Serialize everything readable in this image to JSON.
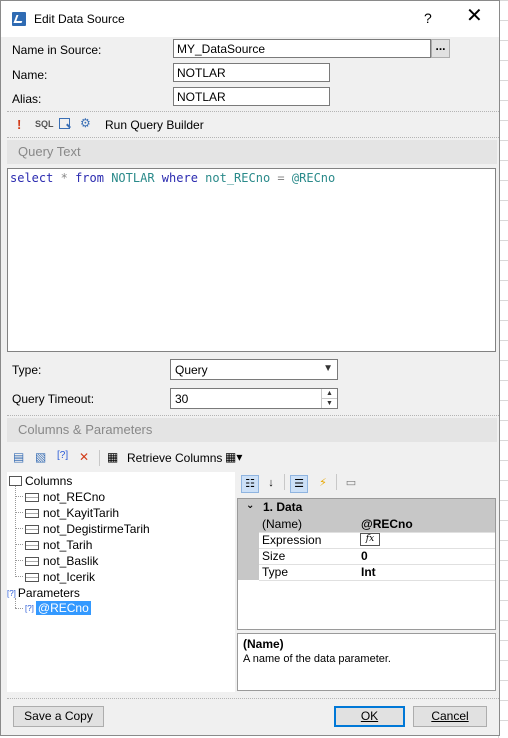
{
  "window": {
    "title": "Edit Data Source",
    "help": "?",
    "close": "✕"
  },
  "form": {
    "name_in_source_label": "Name in Source:",
    "name_in_source_value": "MY_DataSource",
    "browse_button": "...",
    "name_label": "Name:",
    "name_value": "NOTLAR",
    "alias_label": "Alias:",
    "alias_value": "NOTLAR"
  },
  "query_toolbar": {
    "exclamation": "!",
    "sql_label": "SQL",
    "run_query_builder": "Run Query Builder"
  },
  "query_text": {
    "header": "Query Text",
    "tokens": {
      "select": "select",
      "star": "*",
      "from": "from",
      "table": "NOTLAR",
      "where": "where",
      "column": "not_RECno",
      "equals": "=",
      "param": "@RECno"
    }
  },
  "type": {
    "label": "Type:",
    "value": "Query"
  },
  "timeout": {
    "label": "Query Timeout:",
    "value": "30"
  },
  "columns_params": {
    "header": "Columns & Parameters",
    "retrieve_columns": "Retrieve Columns",
    "tree": {
      "columns_label": "Columns",
      "columns": [
        "not_RECno",
        "not_KayitTarih",
        "not_DegistirmeTarih",
        "not_Tarih",
        "not_Baslik",
        "not_Icerik"
      ],
      "parameters_label": "Parameters",
      "parameters": [
        "@RECno"
      ]
    }
  },
  "properties": {
    "category": "1. Data",
    "rows": [
      {
        "name": "(Name)",
        "value": "@RECno"
      },
      {
        "name": "Expression",
        "value": "fx"
      },
      {
        "name": "Size",
        "value": "0"
      },
      {
        "name": "Type",
        "value": "Int"
      }
    ],
    "description_title": "(Name)",
    "description_text": "A name of the data parameter."
  },
  "buttons": {
    "save_copy": "Save a Copy",
    "ok": "OK",
    "cancel": "Cancel"
  }
}
